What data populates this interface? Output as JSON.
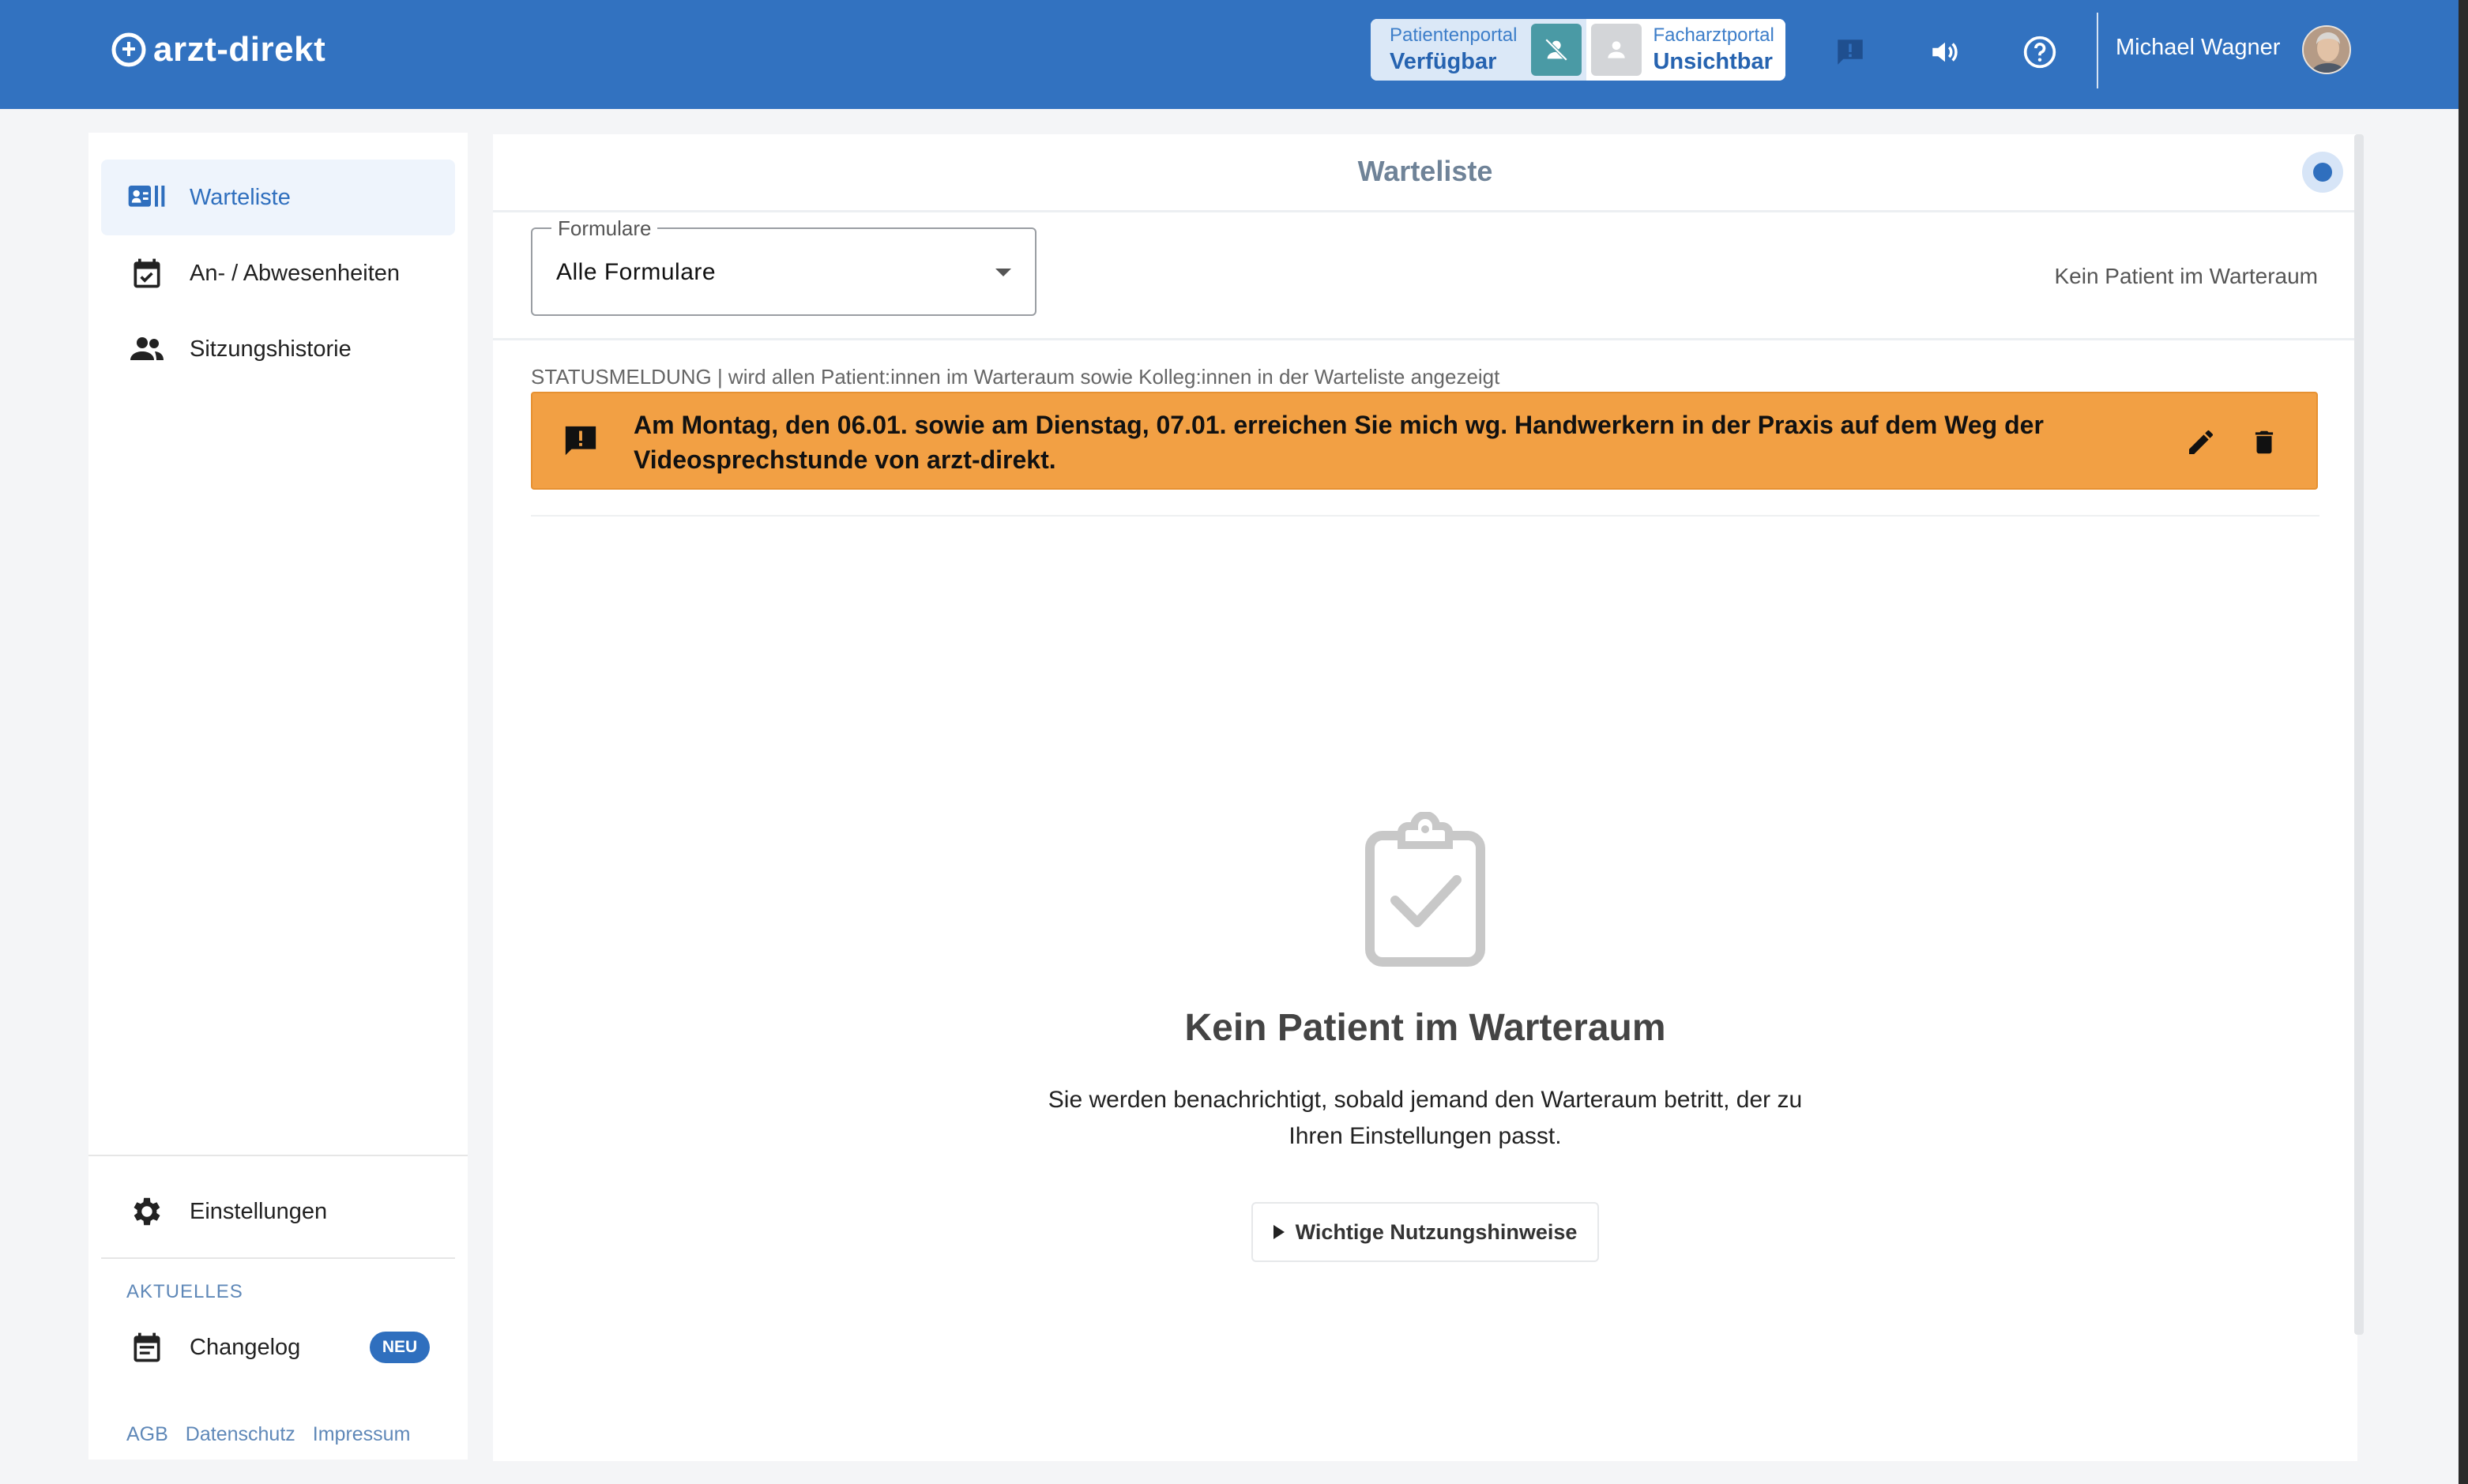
{
  "header": {
    "logo": "arzt-direkt",
    "patientenportal": {
      "name": "Patientenportal",
      "status": "Verfügbar"
    },
    "facharztportal": {
      "name": "Facharztportal",
      "status": "Unsichtbar"
    },
    "user_name": "Michael Wagner",
    "icons": [
      "feedback-icon",
      "volume-icon",
      "help-icon"
    ]
  },
  "sidebar": {
    "items": [
      {
        "label": "Warteliste",
        "icon": "waitlist-icon",
        "active": true
      },
      {
        "label": "An- / Abwesenheiten",
        "icon": "calendar-check-icon"
      },
      {
        "label": "Sitzungshistorie",
        "icon": "people-icon"
      }
    ],
    "settings_label": "Einstellungen",
    "section_label": "AKTUELLES",
    "changelog_label": "Changelog",
    "changelog_badge": "NEU",
    "footer_links": [
      "AGB",
      "Datenschutz",
      "Impressum"
    ]
  },
  "main": {
    "title": "Warteliste",
    "select": {
      "legend": "Formulare",
      "value": "Alle Formulare"
    },
    "no_patient_short": "Kein Patient im Warteraum",
    "status_caption": "STATUSMELDUNG | wird allen Patient:innen im Warteraum sowie Kolleg:innen in der Warteliste angezeigt",
    "status_message": "Am Montag, den 06.01. sowie am Dienstag, 07.01. erreichen Sie mich wg. Handwerkern in der Praxis auf dem Weg der Videosprechstunde von arzt-direkt.",
    "empty_title": "Kein Patient im Warteraum",
    "empty_desc": "Sie werden benachrichtigt, sobald jemand den Warteraum betritt, der zu Ihren Einstellungen passt.",
    "hints_button": "Wichtige Nutzungshinweise"
  },
  "colors": {
    "header_bg": "#3272c0",
    "accent": "#2f6fbe",
    "banner_bg": "#f2a044",
    "portal_available": "#4a9aa5"
  }
}
